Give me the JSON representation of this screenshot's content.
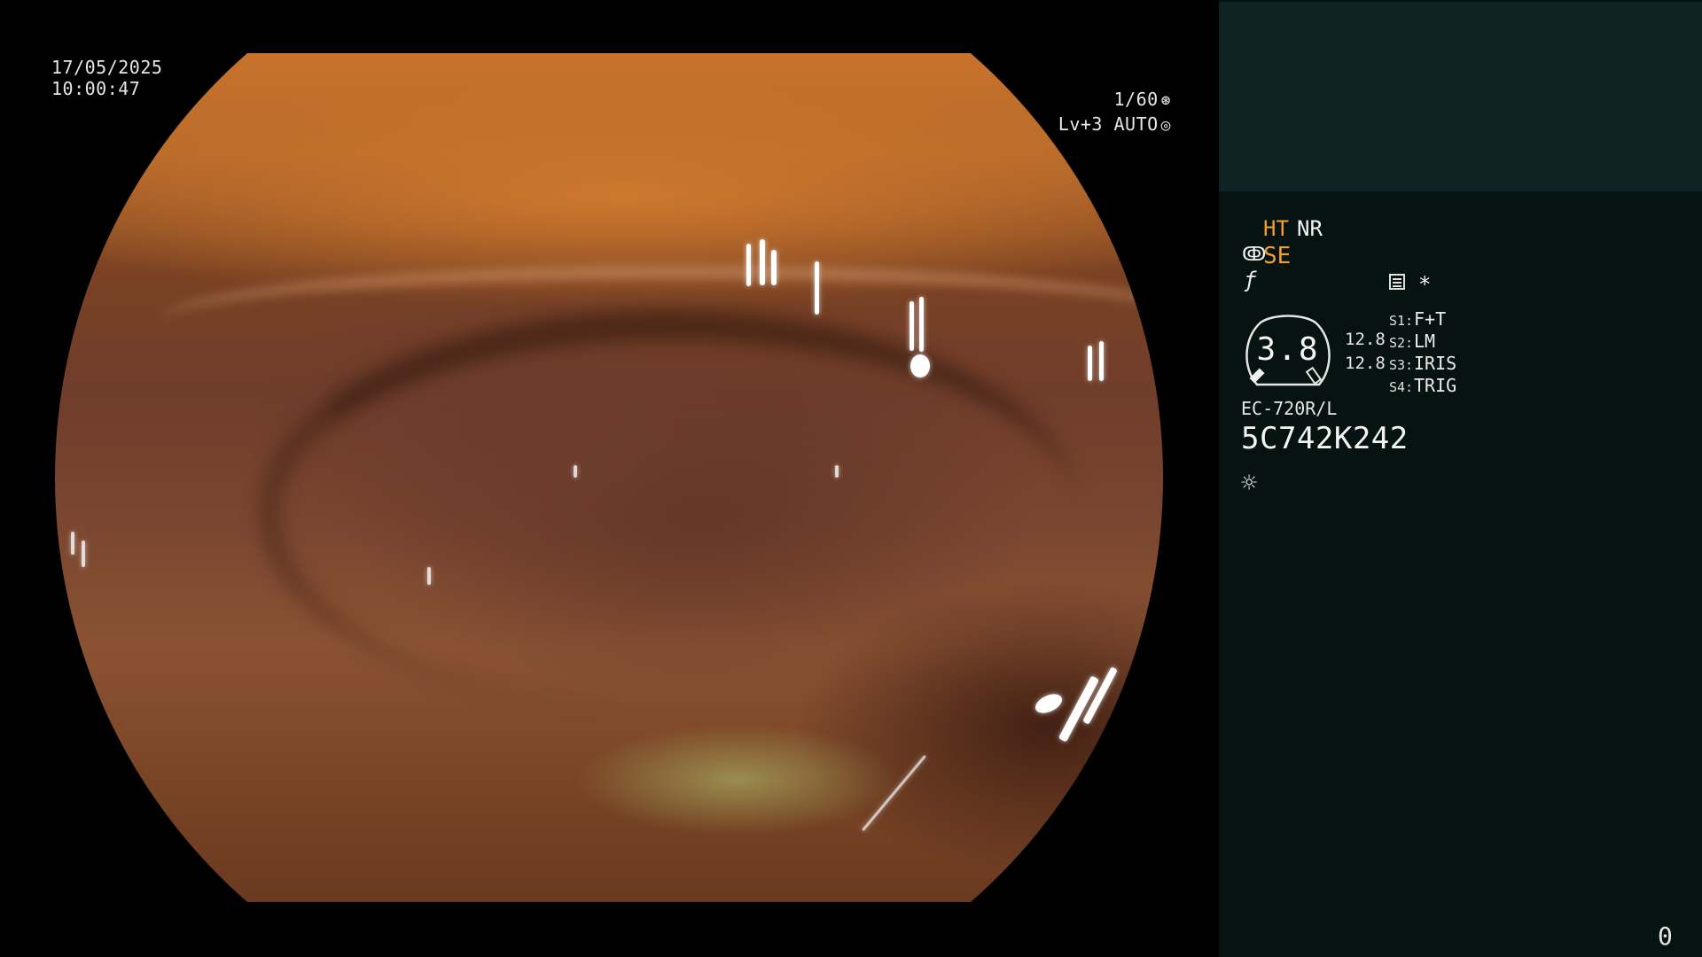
{
  "overlay": {
    "date": "17/05/2025",
    "time": "10:00:47",
    "shutter": "1/60",
    "shutter_icon": "shutter-icon",
    "level": "Lv+3 AUTO",
    "level_icon": "iris-icon"
  },
  "panel": {
    "ht_label": "HT",
    "nr_label": "NR",
    "se_icon": "structure-enhance-icon",
    "se_label": "SE",
    "f_icon": "f-symbol-icon",
    "menu_icon": "menu-list-icon",
    "asterisk": "*",
    "gauge_value": "3.8",
    "side_value_1": "12.8",
    "side_value_2": "12.8",
    "buttons": [
      {
        "key": "S1:",
        "value": "F+T"
      },
      {
        "key": "S2:",
        "value": "LM"
      },
      {
        "key": "S3:",
        "value": "IRIS"
      },
      {
        "key": "S4:",
        "value": "TRIG"
      }
    ],
    "scope_model": "EC-720R/L",
    "serial_number": "5C742K242",
    "lamp_icon": "lamp-sun-icon",
    "counter": "0"
  },
  "colors": {
    "highlight": "#f0a030",
    "panel_bg": "#061311",
    "panel_top_bg": "#0f2324",
    "text": "#e6e6e6"
  }
}
